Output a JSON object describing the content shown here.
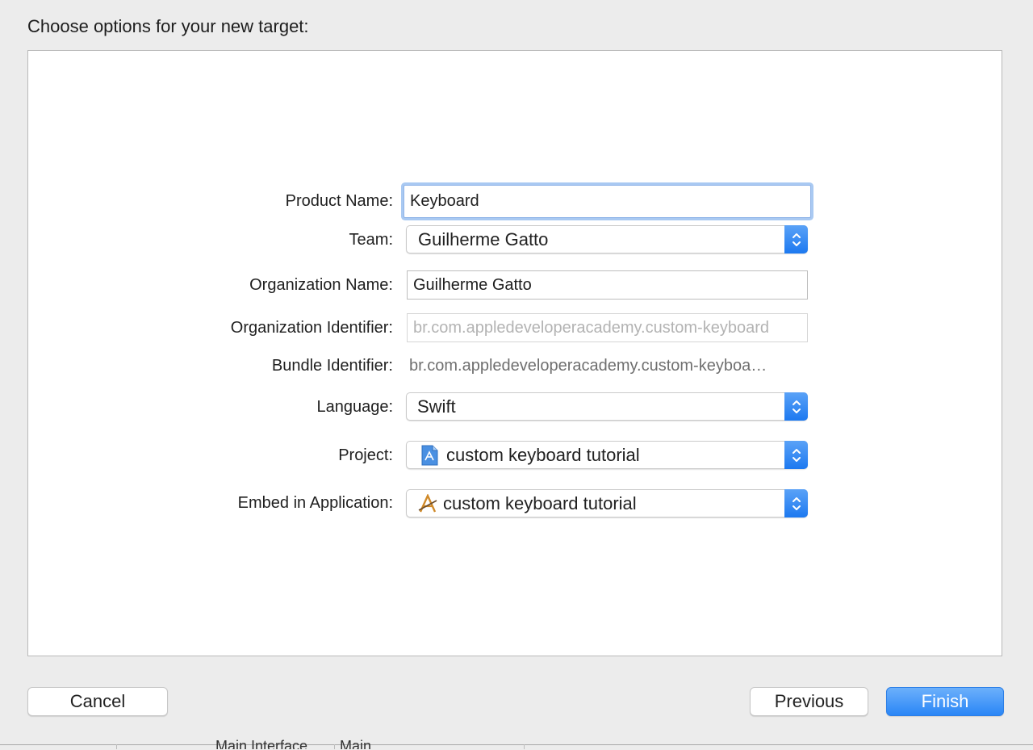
{
  "heading": "Choose options for your new target:",
  "form": {
    "product_name": {
      "label": "Product Name:",
      "value": "Keyboard"
    },
    "team": {
      "label": "Team:",
      "value": "Guilherme Gatto"
    },
    "organization_name": {
      "label": "Organization Name:",
      "value": "Guilherme Gatto"
    },
    "organization_identifier": {
      "label": "Organization Identifier:",
      "placeholder": "br.com.appledeveloperacademy.custom-keyboard"
    },
    "bundle_identifier": {
      "label": "Bundle Identifier:",
      "value": "br.com.appledeveloperacademy.custom-keyboa…"
    },
    "language": {
      "label": "Language:",
      "value": "Swift"
    },
    "project": {
      "label": "Project:",
      "value": "custom keyboard tutorial",
      "icon": "xcode-project-file-icon"
    },
    "embed": {
      "label": "Embed in Application:",
      "value": "custom keyboard tutorial",
      "icon": "app-icon"
    }
  },
  "buttons": {
    "cancel": "Cancel",
    "previous": "Previous",
    "finish": "Finish"
  },
  "background_window": {
    "main_interface_label": "Main Interface",
    "main_interface_value": "Main"
  },
  "colors": {
    "accent": "#2a86f6",
    "focus_ring": "#a9c9f2",
    "panel_bg": "#ffffff",
    "window_bg": "#ececec"
  }
}
